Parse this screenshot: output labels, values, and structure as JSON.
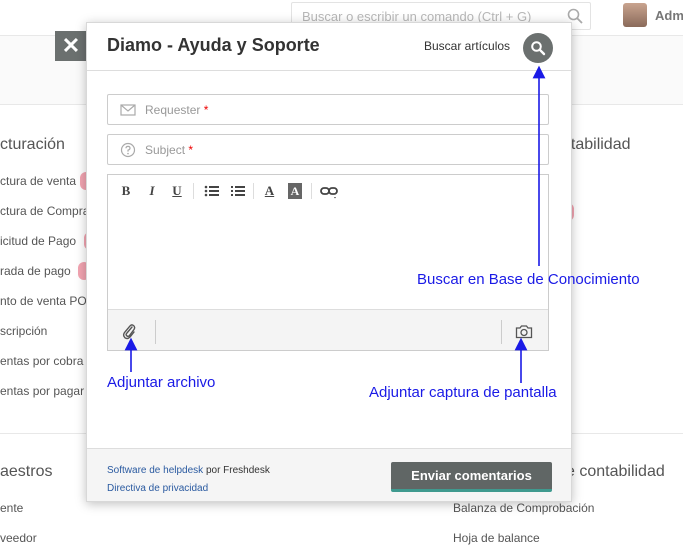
{
  "app": {
    "search_placeholder": "Buscar o escribir un comando (Ctrl + G)",
    "user_label": "Adm",
    "close_label": "✕"
  },
  "background": {
    "section_left_heading": "cturación",
    "section_right_heading": "ntabilidad",
    "left_items": [
      "ctura de venta",
      "ctura de Compra",
      "icitud de Pago",
      "rada de pago",
      "nto de venta PO",
      "scripción",
      "entas por cobra",
      "entas por pagar"
    ],
    "bottom_left_heading": "aestros",
    "bottom_left_items": [
      "ente",
      "veedor"
    ],
    "bottom_right_heading": "e contabilidad",
    "bottom_right_items": [
      "Balanza de Comprobación",
      "Hoja de balance"
    ]
  },
  "modal": {
    "title": "Diamo - Ayuda y Soporte",
    "search_articles_label": "Buscar artículos",
    "requester_placeholder": "Requester",
    "subject_placeholder": "Subject",
    "required_mark": "*",
    "toolbar": {
      "bold": "B",
      "italic": "I",
      "underline": "U",
      "font_color": "A",
      "bg_color": "A"
    },
    "footer": {
      "link_software": "Software de helpdesk",
      "by_text": "por Freshdesk",
      "link_privacy": "Directiva de privacidad",
      "send_button": "Enviar comentarios"
    }
  },
  "annotations": {
    "search_kb": "Buscar en Base de Conocimiento",
    "attach_file": "Adjuntar archivo",
    "attach_screenshot": "Adjuntar captura de pantalla"
  },
  "colors": {
    "accent_annotation": "#1a1ae6",
    "button_dark": "#606665",
    "button_underline": "#3f9a8f",
    "required": "#ee0000",
    "link": "#2a5aa0"
  }
}
